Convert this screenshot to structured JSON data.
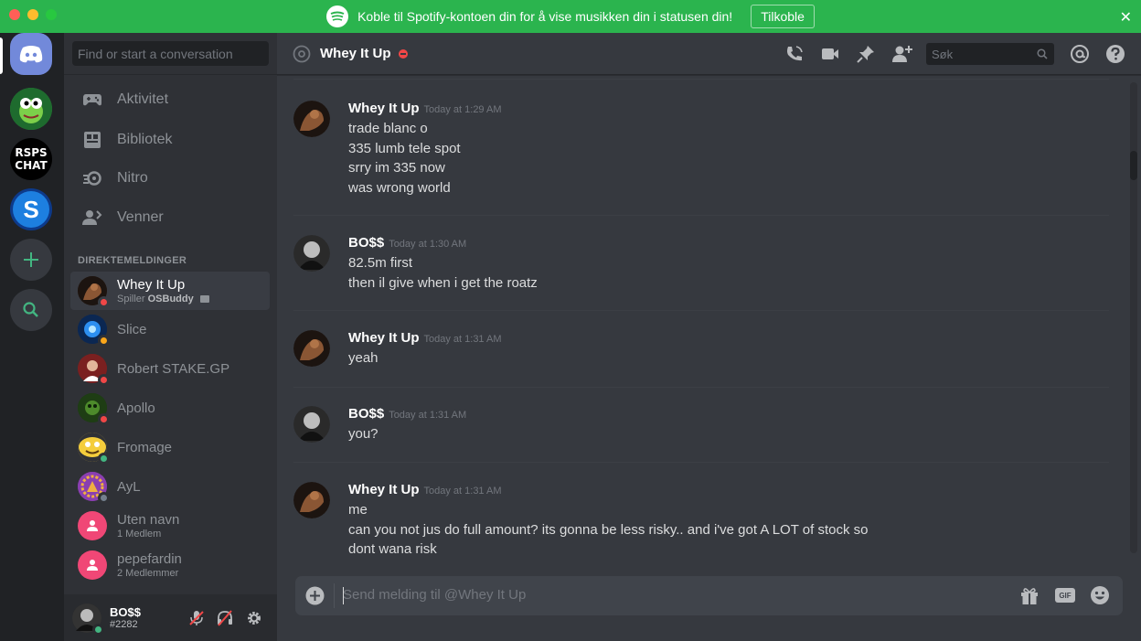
{
  "banner": {
    "message": "Koble til Spotify-kontoen din for å vise musikken din i statusen din!",
    "connect_label": "Tilkoble",
    "close_glyph": "✕"
  },
  "guilds": [
    {
      "name": "discord-home"
    },
    {
      "name": "frog-server"
    },
    {
      "name": "rsps-chat-server",
      "label": "RSPS CHAT"
    },
    {
      "name": "s-server",
      "label": "S"
    },
    {
      "name": "add-server"
    },
    {
      "name": "explore-servers"
    }
  ],
  "sidebar": {
    "search_placeholder": "Find or start a conversation",
    "nav": [
      {
        "label": "Aktivitet",
        "icon": "gamepad-icon"
      },
      {
        "label": "Bibliotek",
        "icon": "library-icon"
      },
      {
        "label": "Nitro",
        "icon": "nitro-icon"
      },
      {
        "label": "Venner",
        "icon": "friends-icon"
      }
    ],
    "dm_header": "DIREKTEMELDINGER",
    "dms": [
      {
        "name": "Whey It Up",
        "sub_prefix": "Spiller ",
        "sub_game": "OSBuddy",
        "status": "dnd"
      },
      {
        "name": "Slice",
        "sub": "",
        "status": "idle"
      },
      {
        "name": "Robert STAKE.GP",
        "sub": "",
        "status": "dnd"
      },
      {
        "name": "Apollo",
        "sub": "",
        "status": "dnd"
      },
      {
        "name": "Fromage",
        "sub": "",
        "status": "online"
      },
      {
        "name": "AyL",
        "sub": "",
        "status": "offline"
      },
      {
        "name": "Uten navn",
        "sub": "1 Medlem",
        "status": "group"
      },
      {
        "name": "pepefardin",
        "sub": "2 Medlemmer",
        "status": "group"
      }
    ]
  },
  "user": {
    "name": "BO$$",
    "tag": "#2282"
  },
  "header": {
    "channel_name": "Whey It Up",
    "search_placeholder": "Søk"
  },
  "messages": [
    {
      "author": "Whey It Up",
      "time": "Today at 1:29 AM",
      "lines": [
        "trade blanc o",
        "335 lumb tele spot",
        "srry im 335 now",
        "was wrong world"
      ]
    },
    {
      "author": "BO$$",
      "time": "Today at 1:30 AM",
      "lines": [
        "82.5m first",
        "then il give when i get the roatz"
      ]
    },
    {
      "author": "Whey It Up",
      "time": "Today at 1:31 AM",
      "lines": [
        "yeah"
      ]
    },
    {
      "author": "BO$$",
      "time": "Today at 1:31 AM",
      "lines": [
        "you?"
      ]
    },
    {
      "author": "Whey It Up",
      "time": "Today at 1:31 AM",
      "lines": [
        "me",
        "can you not jus do full amount? its gonna be less risky.. and i've got A LOT of stock so",
        "dont wana risk"
      ]
    }
  ],
  "composer": {
    "placeholder": "Send melding til @Whey It Up",
    "gif_label": "GIF"
  },
  "colors": {
    "banner": "#2bb44e",
    "dnd": "#f04747",
    "idle": "#faa61a",
    "online": "#43b581",
    "offline": "#747f8d",
    "blurple": "#7289da",
    "group": "#f04776"
  }
}
